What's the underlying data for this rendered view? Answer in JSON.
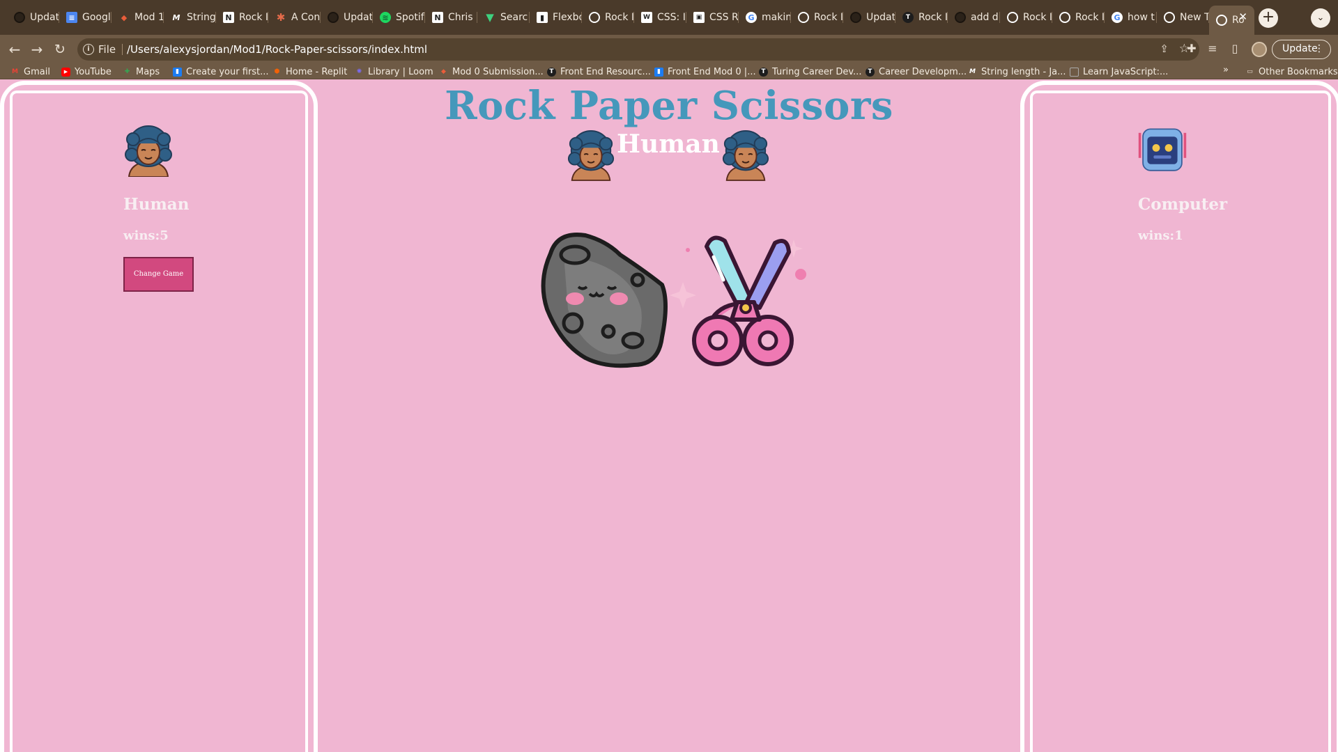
{
  "browser": {
    "tabs": [
      {
        "label": "Updat",
        "icon": "github-icon"
      },
      {
        "label": "Googl",
        "icon": "google-docs-icon"
      },
      {
        "label": "Mod 1",
        "icon": "mod-icon"
      },
      {
        "label": "String",
        "icon": "mdn-icon"
      },
      {
        "label": "Rock I",
        "icon": "notion-icon"
      },
      {
        "label": "A Con",
        "icon": "asterisk-icon"
      },
      {
        "label": "Updat",
        "icon": "github-icon"
      },
      {
        "label": "Spotif",
        "icon": "spotify-icon"
      },
      {
        "label": "Chris",
        "icon": "notion-icon"
      },
      {
        "label": "Searc",
        "icon": "vue-icon"
      },
      {
        "label": "Flexbo",
        "icon": "trello-icon"
      },
      {
        "label": "Rock I",
        "icon": "globe-icon"
      },
      {
        "label": "CSS: I",
        "icon": "w3-icon"
      },
      {
        "label": "CSS R",
        "icon": "css-icon"
      },
      {
        "label": "makin",
        "icon": "google-icon"
      },
      {
        "label": "Rock I",
        "icon": "globe-icon"
      },
      {
        "label": "Updat",
        "icon": "github-icon"
      },
      {
        "label": "Rock I",
        "icon": "turing-icon"
      },
      {
        "label": "add di",
        "icon": "github-icon"
      },
      {
        "label": "Rock I",
        "icon": "globe-icon"
      },
      {
        "label": "Rock I",
        "icon": "globe-icon"
      },
      {
        "label": "how t",
        "icon": "google-icon"
      },
      {
        "label": "New T",
        "icon": "globe-icon"
      },
      {
        "label": "Ro",
        "icon": "globe-icon",
        "active": true
      }
    ],
    "address": {
      "scheme_label": "File",
      "url": "/Users/alexysjordan/Mod1/Rock-Paper-scissors/index.html"
    },
    "update_label": "Update",
    "bookmarks": [
      {
        "label": "Gmail",
        "icon": "gmail-icon"
      },
      {
        "label": "YouTube",
        "icon": "youtube-icon"
      },
      {
        "label": "Maps",
        "icon": "maps-icon"
      },
      {
        "label": "Create your first...",
        "icon": "trello-icon"
      },
      {
        "label": "Home - Replit",
        "icon": "replit-icon"
      },
      {
        "label": "Library | Loom",
        "icon": "loom-icon"
      },
      {
        "label": "Mod 0 Submission...",
        "icon": "mod-icon"
      },
      {
        "label": "Front End Resourc...",
        "icon": "turing-icon"
      },
      {
        "label": "Front End Mod 0 |...",
        "icon": "trello-icon"
      },
      {
        "label": "Turing Career Dev...",
        "icon": "turing-icon"
      },
      {
        "label": "Career Developm...",
        "icon": "turing-icon"
      },
      {
        "label": "String length - Ja...",
        "icon": "mdn-icon"
      },
      {
        "label": "Learn JavaScript:...",
        "icon": "frame-icon"
      }
    ],
    "bookmarks_more": "»",
    "other_bookmarks": "Other Bookmarks"
  },
  "game": {
    "title": "Rock Paper Scissors",
    "banner": "Human",
    "human": {
      "name": "Human",
      "wins": "wins:5",
      "avatar": "human-avatar-icon"
    },
    "computer": {
      "name": "Computer",
      "wins": "wins:1",
      "avatar": "robot-avatar-icon"
    },
    "change_game_label": "Change Game",
    "choices_shown": [
      "rock-icon",
      "scissors-icon"
    ]
  },
  "colors": {
    "page_bg": "#f0b6d2",
    "title": "#4598bb",
    "button": "#d2497f",
    "text": "#f8eef2"
  }
}
